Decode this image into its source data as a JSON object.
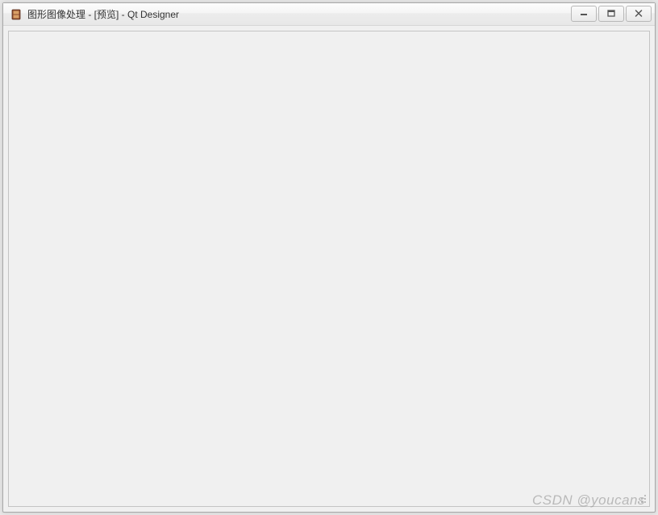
{
  "window": {
    "title": "图形图像处理 - [预览] - Qt Designer"
  },
  "watermark": {
    "text": "CSDN @youcans"
  }
}
